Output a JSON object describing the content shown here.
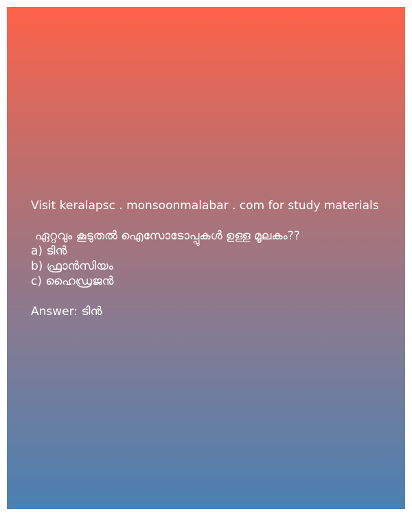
{
  "promo": "Visit keralapsc . monsoonmalabar . com for study materials",
  "question": "ഏറ്റവും കൂടുതൽ ഐസോടോപ്പുകൾ ഉള്ള മൂലകം??",
  "options": [
    "a) ടിൻ",
    "b) ഫ്രാൻസിയം",
    "c) ഹൈഡ്രജൻ"
  ],
  "answer": "Answer: ടിൻ",
  "colors": {
    "gradient_top": "#fe624a",
    "gradient_bottom": "#4a80b2",
    "text": "#ffffff"
  }
}
